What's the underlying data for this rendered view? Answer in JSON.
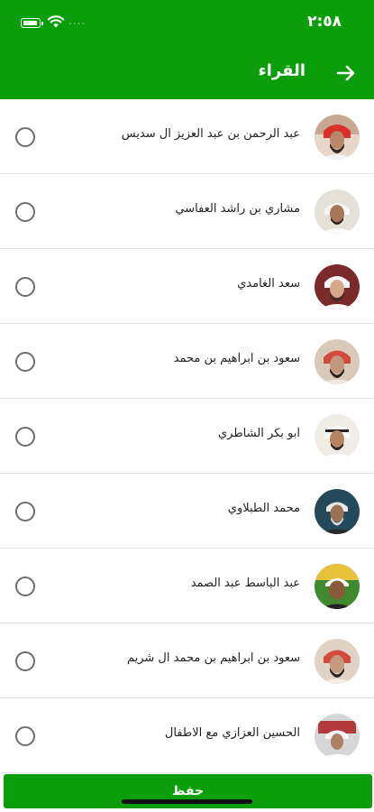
{
  "status_bar": {
    "time": "٢:٥٨",
    "carrier": "...."
  },
  "header": {
    "title": "القراء",
    "back_icon": "arrow-right-icon"
  },
  "reciters": [
    {
      "name": "عبد الرحمن بن عبد العزيز ال سديس",
      "selected": false
    },
    {
      "name": "مشاري بن راشد العفاسي",
      "selected": false
    },
    {
      "name": "سعد الغامدي",
      "selected": false
    },
    {
      "name": "سعود بن ابراهيم بن محمد",
      "selected": false
    },
    {
      "name": "ابو بكر الشاطري",
      "selected": false
    },
    {
      "name": "محمد الطبلاوي",
      "selected": false
    },
    {
      "name": "عبد الباسط عبد الصمد",
      "selected": false
    },
    {
      "name": "سعود بن ابراهيم بن محمد ال شريم",
      "selected": false
    },
    {
      "name": "الحسين العزازي مع الاطفال",
      "selected": false
    }
  ],
  "footer": {
    "save_label": "حفظ"
  },
  "colors": {
    "primary": "#0a9e0a",
    "radio_border": "#6d6d6d",
    "divider": "#e2e2e2"
  }
}
